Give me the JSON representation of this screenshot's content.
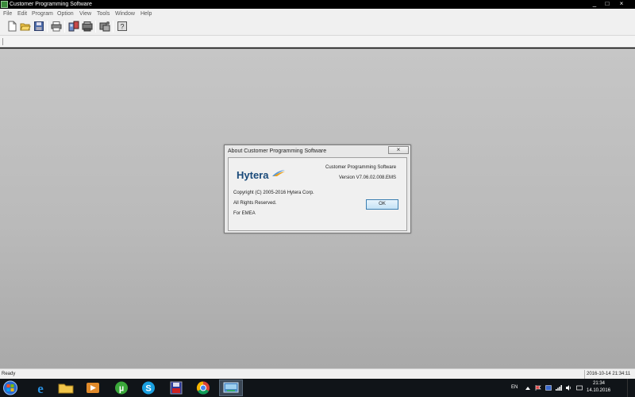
{
  "window": {
    "title": "Customer Programming Software"
  },
  "menu": [
    "File",
    "Edit",
    "Program",
    "Option",
    "View",
    "Tools",
    "Window",
    "Help"
  ],
  "dialog": {
    "title": "About Customer Programming Software",
    "close_label": "×",
    "logo_text": "Hytera",
    "product_name": "Customer Programming Software",
    "version": "Version V7.06.02.008.EMS",
    "copyright": "Copyright (C) 2005-2016 Hytera Corp.",
    "rights": "All Rights Reserved.",
    "region": "For EMEA",
    "ok_label": "OK"
  },
  "statusbar": {
    "status": "Ready",
    "datetime": "2016-10-14 21:34:11"
  },
  "taskbar": {
    "language": "EN",
    "time": "21:34",
    "date": "14.10.2016"
  },
  "colors": {
    "workspace": "#bcbcbc",
    "ok_border": "#3c7fb1",
    "taskbar": "#101418"
  }
}
